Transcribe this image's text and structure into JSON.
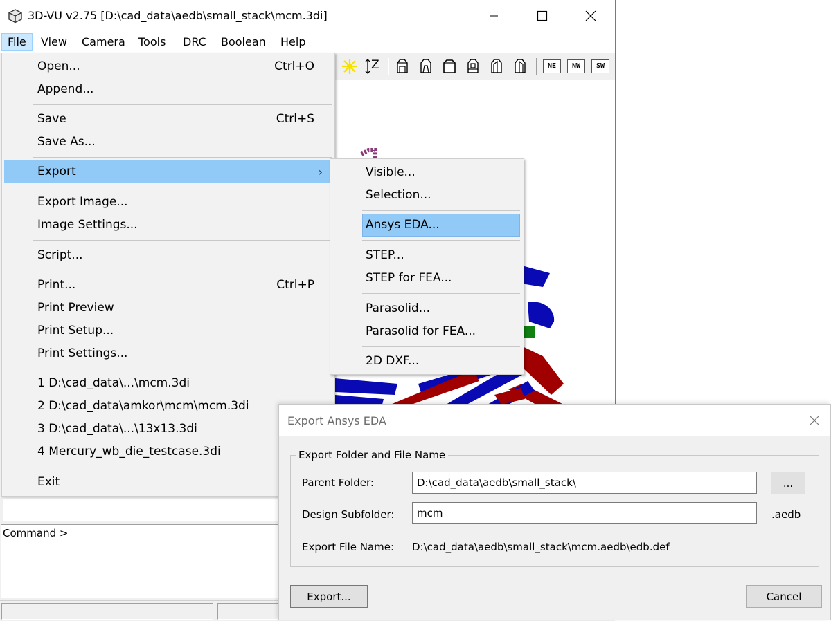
{
  "window": {
    "title": "3D-VU v2.75 [D:\\cad_data\\aedb\\small_stack\\mcm.3di]"
  },
  "menubar": {
    "items": [
      "File",
      "View",
      "Camera",
      "Tools",
      "DRC",
      "Boolean",
      "Help"
    ],
    "open_item": "File"
  },
  "toolbar": {
    "z_label": "Z",
    "view_labels": [
      "NE",
      "NW",
      "SW"
    ]
  },
  "file_menu": {
    "open": {
      "label": "Open...",
      "shortcut": "Ctrl+O"
    },
    "append": {
      "label": "Append..."
    },
    "save": {
      "label": "Save",
      "shortcut": "Ctrl+S"
    },
    "save_as": {
      "label": "Save As..."
    },
    "export": {
      "label": "Export"
    },
    "export_image": {
      "label": "Export Image..."
    },
    "image_settings": {
      "label": "Image Settings..."
    },
    "script": {
      "label": "Script..."
    },
    "print": {
      "label": "Print...",
      "shortcut": "Ctrl+P"
    },
    "print_preview": {
      "label": "Print Preview"
    },
    "print_setup": {
      "label": "Print Setup..."
    },
    "print_settings": {
      "label": "Print Settings..."
    },
    "recent": [
      "1 D:\\cad_data\\...\\mcm.3di",
      "2 D:\\cad_data\\amkor\\mcm\\mcm.3di",
      "3 D:\\cad_data\\...\\13x13.3di",
      "4 Mercury_wb_die_testcase.3di"
    ],
    "exit": {
      "label": "Exit"
    }
  },
  "export_submenu": {
    "visible": "Visible...",
    "selection": "Selection...",
    "ansys_eda": "Ansys EDA...",
    "step": "STEP...",
    "step_fea": "STEP for FEA...",
    "parasolid": "Parasolid...",
    "parasolid_fea": "Parasolid for FEA...",
    "dxf_2d": "2D DXF..."
  },
  "command": {
    "prompt": "Command >",
    "value": ""
  },
  "dialog": {
    "title": "Export Ansys EDA",
    "group_title": "Export Folder and File Name",
    "parent_folder_label": "Parent Folder:",
    "parent_folder_value": "D:\\cad_data\\aedb\\small_stack\\",
    "browse_label": "...",
    "design_subfolder_label": "Design Subfolder:",
    "design_subfolder_value": "mcm",
    "suffix": ".aedb",
    "export_file_name_label": "Export File Name:",
    "export_file_name_value": "D:\\cad_data\\aedb\\small_stack\\mcm.aedb\\edb.def",
    "export_button": "Export...",
    "cancel_button": "Cancel"
  },
  "colors": {
    "menu_highlight": "#91c9f7",
    "menubar_open": "#cce8ff",
    "trace_blue": "#0a0ab4",
    "trace_red": "#a00000",
    "trace_green": "#108010",
    "trace_purple": "#8a3a7a",
    "toolbar_star": "#f7e000"
  }
}
